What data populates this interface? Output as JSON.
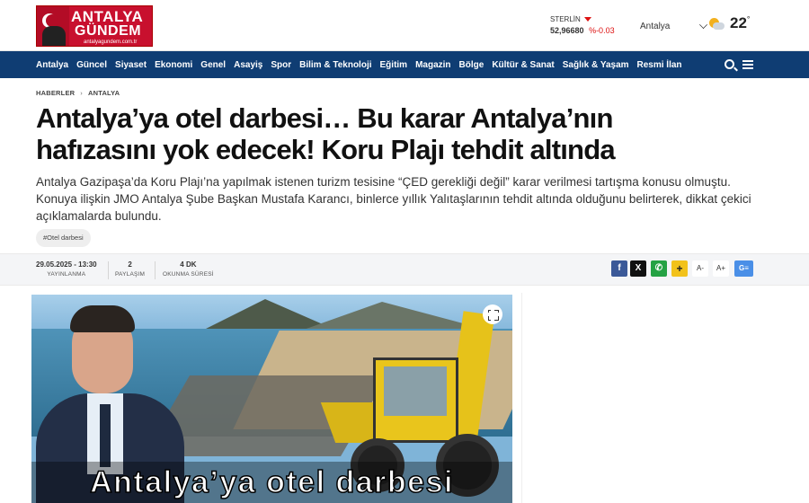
{
  "header": {
    "logo": {
      "line1": "ANTALYA",
      "line2": "GÜNDEM",
      "site": "antalyagundem.com.tr"
    },
    "currency": {
      "name": "STERLİN",
      "value": "52,96680",
      "change": "%-0.03",
      "trend": "down"
    },
    "weather": {
      "city": "Antalya",
      "temperature": "22",
      "unit": "°",
      "icon": "partly-cloudy-icon"
    }
  },
  "nav": {
    "items": [
      "Antalya",
      "Güncel",
      "Siyaset",
      "Ekonomi",
      "Genel",
      "Asayiş",
      "Spor",
      "Bilim & Teknoloji",
      "Eğitim",
      "Magazin",
      "Bölge",
      "Kültür & Sanat",
      "Sağlık & Yaşam",
      "Resmi İlan"
    ],
    "search_icon": "search-icon",
    "menu_icon": "hamburger-menu-icon",
    "color": "#0f3d73"
  },
  "breadcrumb": {
    "home": "HABERLER",
    "section": "ANTALYA"
  },
  "article": {
    "title": "Antalya’ya otel darbesi… Bu karar Antalya’nın hafızasını yok edecek! Koru Plajı tehdit altında",
    "summary": "Antalya Gazipaşa’da Koru Plajı’na yapılmak istenen turizm tesisine “ÇED gerekliği değil” karar verilmesi tartışma konusu olmuştu. Konuya ilişkin JMO Antalya Şube Başkan Mustafa Karancı, binlerce yıllık Yalıtaşlarının tehdit altında olduğunu belirterek, dikkat çekici açıklamalarda bulundu.",
    "tag": "#Otel darbesi",
    "meta": {
      "date": "29.05.2025 - 13:30",
      "date_label": "YAYINLANMA",
      "shares": "2",
      "shares_label": "PAYLAŞIM",
      "read_time": "4 DK",
      "read_time_label": "OKUNMA SÜRESİ"
    },
    "share": {
      "facebook": "f",
      "x": "X",
      "whatsapp": "✆",
      "more": "+"
    },
    "font_small": "A-",
    "font_large": "A+",
    "google_news": "G≡",
    "image_caption": "Antalya’ya otel darbesi"
  }
}
